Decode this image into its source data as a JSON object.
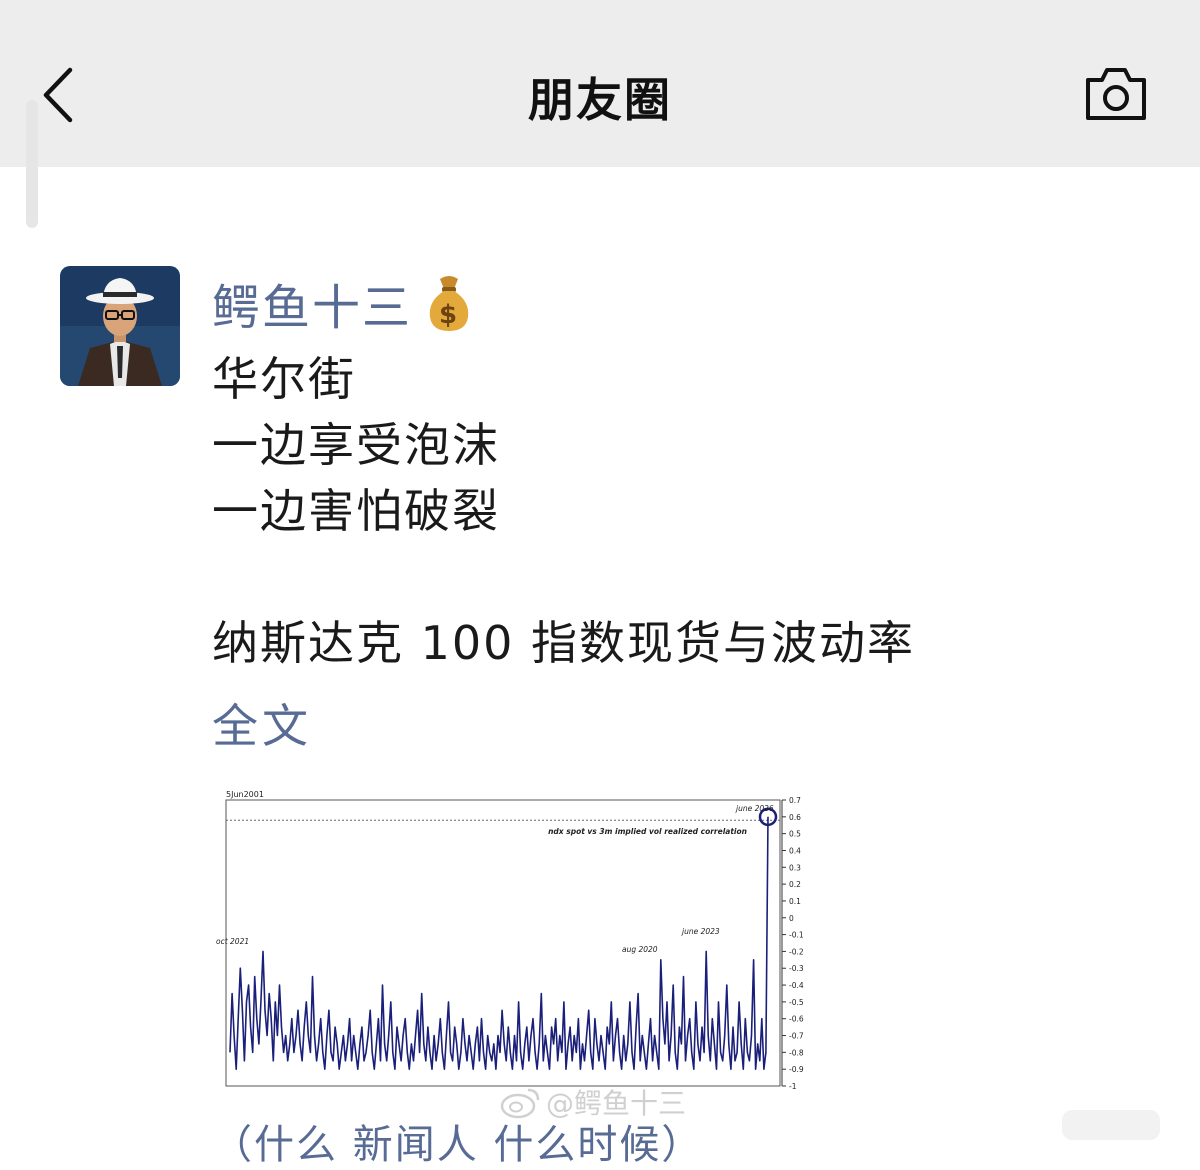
{
  "header": {
    "title": "朋友圈",
    "back_icon": "chevron-left-icon",
    "camera_icon": "camera-icon"
  },
  "post": {
    "username": "鳄鱼十三",
    "username_emoji": "money-bag-icon",
    "text_lines": [
      "华尔街",
      "一边享受泡沫",
      "一边害怕破裂",
      "",
      "纳斯达克 100 指数现货与波动率"
    ],
    "full_text_link": "全文",
    "truncated_next_line": "（什么 新闻人 什么时候）",
    "colors": {
      "link": "#576b95",
      "text": "#1a1a1a",
      "header_bg": "#ededed"
    }
  },
  "chart_data": {
    "type": "line",
    "top_left_label": "5Jun2001",
    "title": "ndx spot vs 3m implied vol realized correlation",
    "annotations": [
      "oct 2021",
      "aug 2020",
      "june 2023",
      "june 2026"
    ],
    "y_ticks": [
      "0.7",
      "0.6",
      "0.5",
      "0.4",
      "0.3",
      "0.2",
      "0.1",
      "0",
      "-0.1",
      "-0.2",
      "-0.3",
      "-0.4",
      "-0.5",
      "-0.6",
      "-0.7",
      "-0.8",
      "-0.9",
      "-1"
    ],
    "ylim": [
      -1,
      0.7
    ],
    "reference_line": 0.58,
    "series": [
      {
        "values": [
          -0.8,
          -0.45,
          -0.7,
          -0.9,
          -0.6,
          -0.3,
          -0.55,
          -0.85,
          -0.5,
          -0.4,
          -0.65,
          -0.8,
          -0.35,
          -0.6,
          -0.75,
          -0.5,
          -0.2,
          -0.55,
          -0.7,
          -0.45,
          -0.6,
          -0.85,
          -0.5,
          -0.7,
          -0.4,
          -0.65,
          -0.8,
          -0.7,
          -0.85,
          -0.75,
          -0.6,
          -0.8,
          -0.7,
          -0.55,
          -0.75,
          -0.85,
          -0.65,
          -0.5,
          -0.7,
          -0.8,
          -0.35,
          -0.7,
          -0.85,
          -0.75,
          -0.6,
          -0.8,
          -0.9,
          -0.7,
          -0.55,
          -0.8,
          -0.85,
          -0.65,
          -0.75,
          -0.9,
          -0.8,
          -0.7,
          -0.85,
          -0.75,
          -0.6,
          -0.85,
          -0.7,
          -0.8,
          -0.9,
          -0.75,
          -0.65,
          -0.85,
          -0.8,
          -0.7,
          -0.55,
          -0.8,
          -0.9,
          -0.75,
          -0.6,
          -0.85,
          -0.4,
          -0.75,
          -0.85,
          -0.7,
          -0.5,
          -0.8,
          -0.9,
          -0.65,
          -0.75,
          -0.85,
          -0.7,
          -0.6,
          -0.8,
          -0.9,
          -0.75,
          -0.85,
          -0.7,
          -0.55,
          -0.8,
          -0.45,
          -0.75,
          -0.85,
          -0.65,
          -0.8,
          -0.9,
          -0.7,
          -0.85,
          -0.75,
          -0.6,
          -0.8,
          -0.9,
          -0.7,
          -0.5,
          -0.8,
          -0.85,
          -0.65,
          -0.75,
          -0.9,
          -0.8,
          -0.6,
          -0.75,
          -0.85,
          -0.7,
          -0.8,
          -0.9,
          -0.75,
          -0.65,
          -0.85,
          -0.6,
          -0.8,
          -0.9,
          -0.7,
          -0.8,
          -0.85,
          -0.75,
          -0.9,
          -0.7,
          -0.8,
          -0.55,
          -0.75,
          -0.85,
          -0.65,
          -0.8,
          -0.9,
          -0.7,
          -0.85,
          -0.5,
          -0.8,
          -0.9,
          -0.75,
          -0.65,
          -0.85,
          -0.7,
          -0.6,
          -0.8,
          -0.9,
          -0.75,
          -0.45,
          -0.85,
          -0.7,
          -0.8,
          -0.9,
          -0.65,
          -0.75,
          -0.6,
          -0.85,
          -0.7,
          -0.8,
          -0.5,
          -0.9,
          -0.75,
          -0.65,
          -0.85,
          -0.7,
          -0.8,
          -0.6,
          -0.9,
          -0.75,
          -0.85,
          -0.7,
          -0.55,
          -0.8,
          -0.9,
          -0.6,
          -0.75,
          -0.85,
          -0.7,
          -0.8,
          -0.9,
          -0.65,
          -0.75,
          -0.5,
          -0.85,
          -0.7,
          -0.6,
          -0.8,
          -0.9,
          -0.7,
          -0.85,
          -0.75,
          -0.5,
          -0.8,
          -0.9,
          -0.65,
          -0.45,
          -0.85,
          -0.7,
          -0.8,
          -0.9,
          -0.75,
          -0.6,
          -0.85,
          -0.7,
          -0.8,
          -0.9,
          -0.25,
          -0.6,
          -0.75,
          -0.5,
          -0.85,
          -0.7,
          -0.4,
          -0.8,
          -0.9,
          -0.65,
          -0.75,
          -0.35,
          -0.85,
          -0.7,
          -0.6,
          -0.8,
          -0.9,
          -0.5,
          -0.75,
          -0.85,
          -0.65,
          -0.8,
          -0.2,
          -0.7,
          -0.85,
          -0.6,
          -0.75,
          -0.9,
          -0.5,
          -0.8,
          -0.85,
          -0.7,
          -0.4,
          -0.75,
          -0.9,
          -0.65,
          -0.85,
          -0.8,
          -0.5,
          -0.75,
          -0.9,
          -0.6,
          -0.8,
          -0.85,
          -0.7,
          -0.25,
          -0.9,
          -0.75,
          -0.85,
          -0.6,
          -0.9,
          -0.8,
          0.6
        ]
      }
    ]
  }
}
